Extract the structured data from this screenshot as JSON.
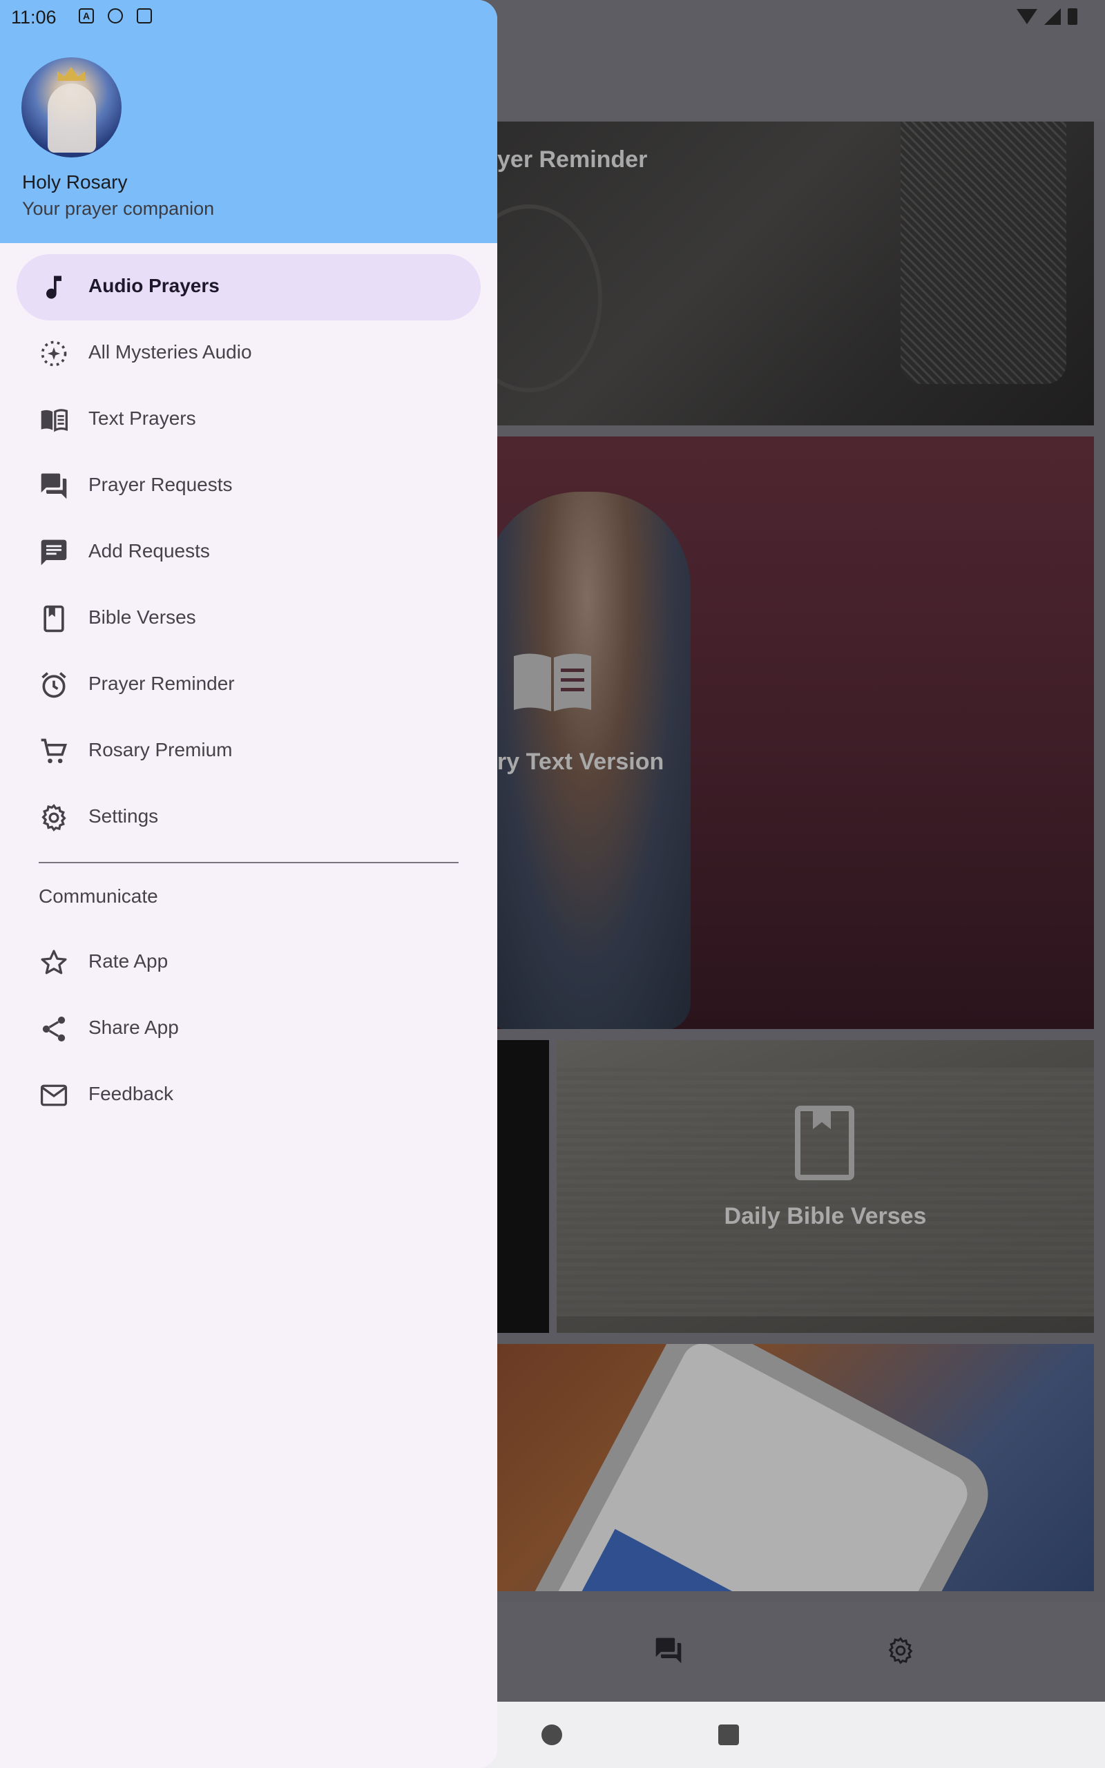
{
  "status_bar": {
    "time": "11:06",
    "icon_a": "A"
  },
  "drawer": {
    "app_name": "Holy Rosary",
    "subtitle": "Your prayer companion",
    "items": [
      {
        "label": "Audio Prayers",
        "icon": "music-note-icon",
        "active": true
      },
      {
        "label": "All Mysteries Audio",
        "icon": "sparkle-circle-icon"
      },
      {
        "label": "Text Prayers",
        "icon": "book-open-icon"
      },
      {
        "label": "Prayer Requests",
        "icon": "forum-icon"
      },
      {
        "label": "Add Requests",
        "icon": "message-icon"
      },
      {
        "label": "Bible Verses",
        "icon": "bookmark-book-icon"
      },
      {
        "label": "Prayer Reminder",
        "icon": "alarm-icon"
      },
      {
        "label": "Rosary Premium",
        "icon": "cart-icon"
      },
      {
        "label": "Settings",
        "icon": "gear-icon"
      }
    ],
    "section_label": "Communicate",
    "communicate": [
      {
        "label": "Rate App",
        "icon": "star-icon"
      },
      {
        "label": "Share App",
        "icon": "share-icon"
      },
      {
        "label": "Feedback",
        "icon": "mail-icon"
      }
    ]
  },
  "background": {
    "card_reminder_title": "yer Reminder",
    "card_text_title": "ry Text Version",
    "card_bible_title": "Daily Bible Verses"
  },
  "colors": {
    "header": "#7cbcf8",
    "drawer_bg": "#f7f2fa",
    "active_item": "#e8def8",
    "scrim": "#5c5b61"
  }
}
